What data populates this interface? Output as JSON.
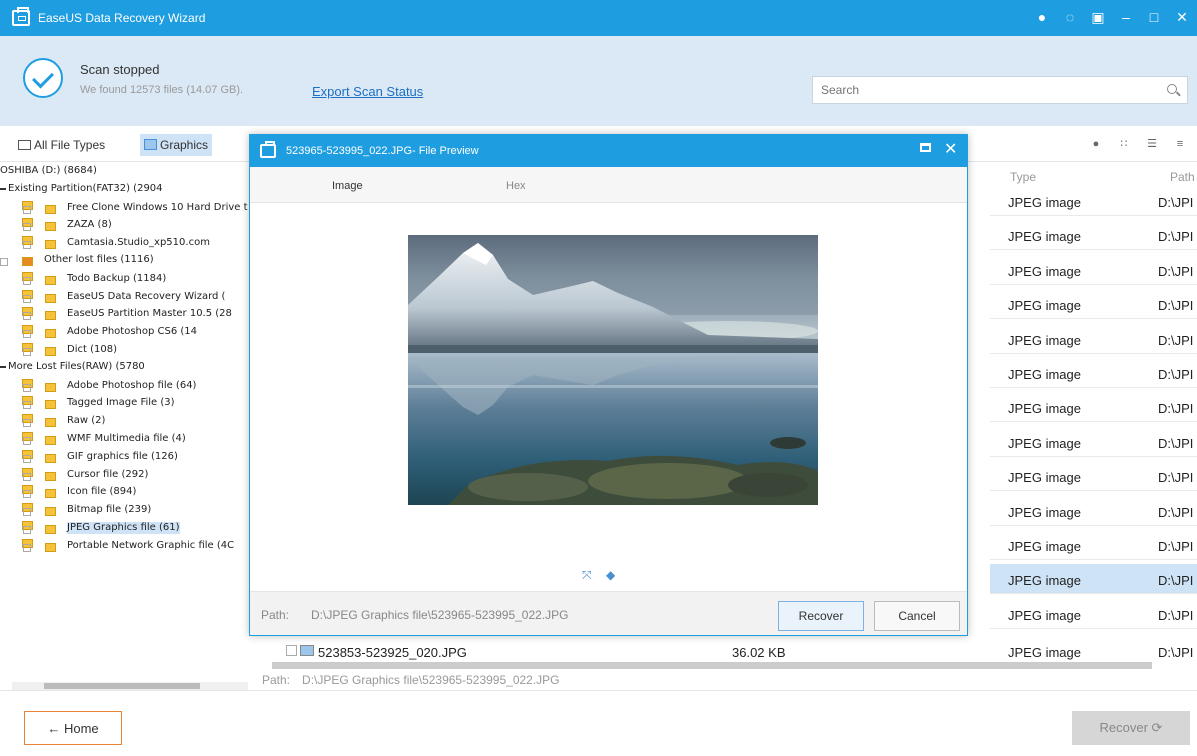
{
  "window": {
    "title": "EaseUS Data Recovery Wizard"
  },
  "title_controls": [
    {
      "name": "feedback-icon",
      "glyph": "●"
    },
    {
      "name": "theme-icon",
      "glyph": "◌"
    },
    {
      "name": "menu-icon",
      "glyph": "▣"
    },
    {
      "name": "minimize-icon",
      "glyph": "–"
    },
    {
      "name": "maximize-icon",
      "glyph": "□"
    },
    {
      "name": "close-icon",
      "glyph": "✕"
    }
  ],
  "status": {
    "title": "Scan stopped",
    "subtitle": "We found 12573 files (14.07 GB).",
    "export_link": "Export Scan Status",
    "search_placeholder": "Search"
  },
  "filters": {
    "all": "All File Types",
    "graphics": "Graphics"
  },
  "tree": [
    {
      "label": "OSHIBA (D:) (8684)",
      "kind": "root"
    },
    {
      "label": "Existing Partition(FAT32) (2904",
      "kind": "group"
    },
    {
      "label": "Free Clone Windows 10 Hard Drive t",
      "kind": "folder"
    },
    {
      "label": "ZAZA (8)",
      "kind": "folder"
    },
    {
      "label": "Camtasia.Studio_xp510.com",
      "kind": "folder"
    },
    {
      "label": "Other lost files (1116)",
      "kind": "lost"
    },
    {
      "label": "Todo Backup (1184)",
      "kind": "folder"
    },
    {
      "label": "EaseUS Data Recovery Wizard (",
      "kind": "folder"
    },
    {
      "label": "EaseUS Partition Master 10.5 (28",
      "kind": "folder"
    },
    {
      "label": "Adobe Photoshop CS6 (14",
      "kind": "folder"
    },
    {
      "label": "Dict (108)",
      "kind": "folder"
    },
    {
      "label": "More Lost Files(RAW) (5780",
      "kind": "group"
    },
    {
      "label": "Adobe Photoshop file (64)",
      "kind": "folder"
    },
    {
      "label": "Tagged Image File (3)",
      "kind": "folder"
    },
    {
      "label": "Raw (2)",
      "kind": "folder"
    },
    {
      "label": "WMF Multimedia file (4)",
      "kind": "folder"
    },
    {
      "label": "GIF graphics file (126)",
      "kind": "folder"
    },
    {
      "label": "Cursor file (292)",
      "kind": "folder"
    },
    {
      "label": "Icon file (894)",
      "kind": "folder"
    },
    {
      "label": "Bitmap file (239)",
      "kind": "folder"
    },
    {
      "label": "JPEG Graphics file (61)",
      "kind": "folder",
      "selected": true
    },
    {
      "label": "Portable Network Graphic file (4C",
      "kind": "folder"
    }
  ],
  "list": {
    "headers": {
      "type": "Type",
      "path": "Path"
    },
    "rows": [
      {
        "type": "JPEG image",
        "path": "D:\\JPI"
      },
      {
        "type": "JPEG image",
        "path": "D:\\JPI"
      },
      {
        "type": "JPEG image",
        "path": "D:\\JPI"
      },
      {
        "type": "JPEG image",
        "path": "D:\\JPI"
      },
      {
        "type": "JPEG image",
        "path": "D:\\JPI"
      },
      {
        "type": "JPEG image",
        "path": "D:\\JPI"
      },
      {
        "type": "JPEG image",
        "path": "D:\\JPI"
      },
      {
        "type": "JPEG image",
        "path": "D:\\JPI"
      },
      {
        "type": "JPEG image",
        "path": "D:\\JPI"
      },
      {
        "type": "JPEG image",
        "path": "D:\\JPI"
      },
      {
        "type": "JPEG image",
        "path": "D:\\JPI"
      },
      {
        "type": "JPEG image",
        "path": "D:\\JPI",
        "selected": true
      },
      {
        "type": "JPEG image",
        "path": "D:\\JPI"
      }
    ],
    "bottom_row": {
      "name": "523853-523925_020.JPG",
      "size": "36.02 KB",
      "type": "JPEG image",
      "path": "D:\\JPI"
    },
    "path_label": "Path:",
    "path_value": "D:\\JPEG Graphics file\\523965-523995_022.JPG"
  },
  "footer": {
    "home": "← Home",
    "recover": "Recover ⟳"
  },
  "dialog": {
    "title": "523965-523995_022.JPG- File Preview",
    "tab_image": "Image",
    "tab_hex": "Hex",
    "path_label": "Path:",
    "path_value": "D:\\JPEG Graphics file\\523965-523995_022.JPG",
    "recover": "Recover",
    "cancel": "Cancel"
  },
  "colors": {
    "accent": "#1e9ee0",
    "header_bg": "#dbe9f6",
    "selection": "#cfe3f6",
    "home_border": "#e8833a"
  }
}
